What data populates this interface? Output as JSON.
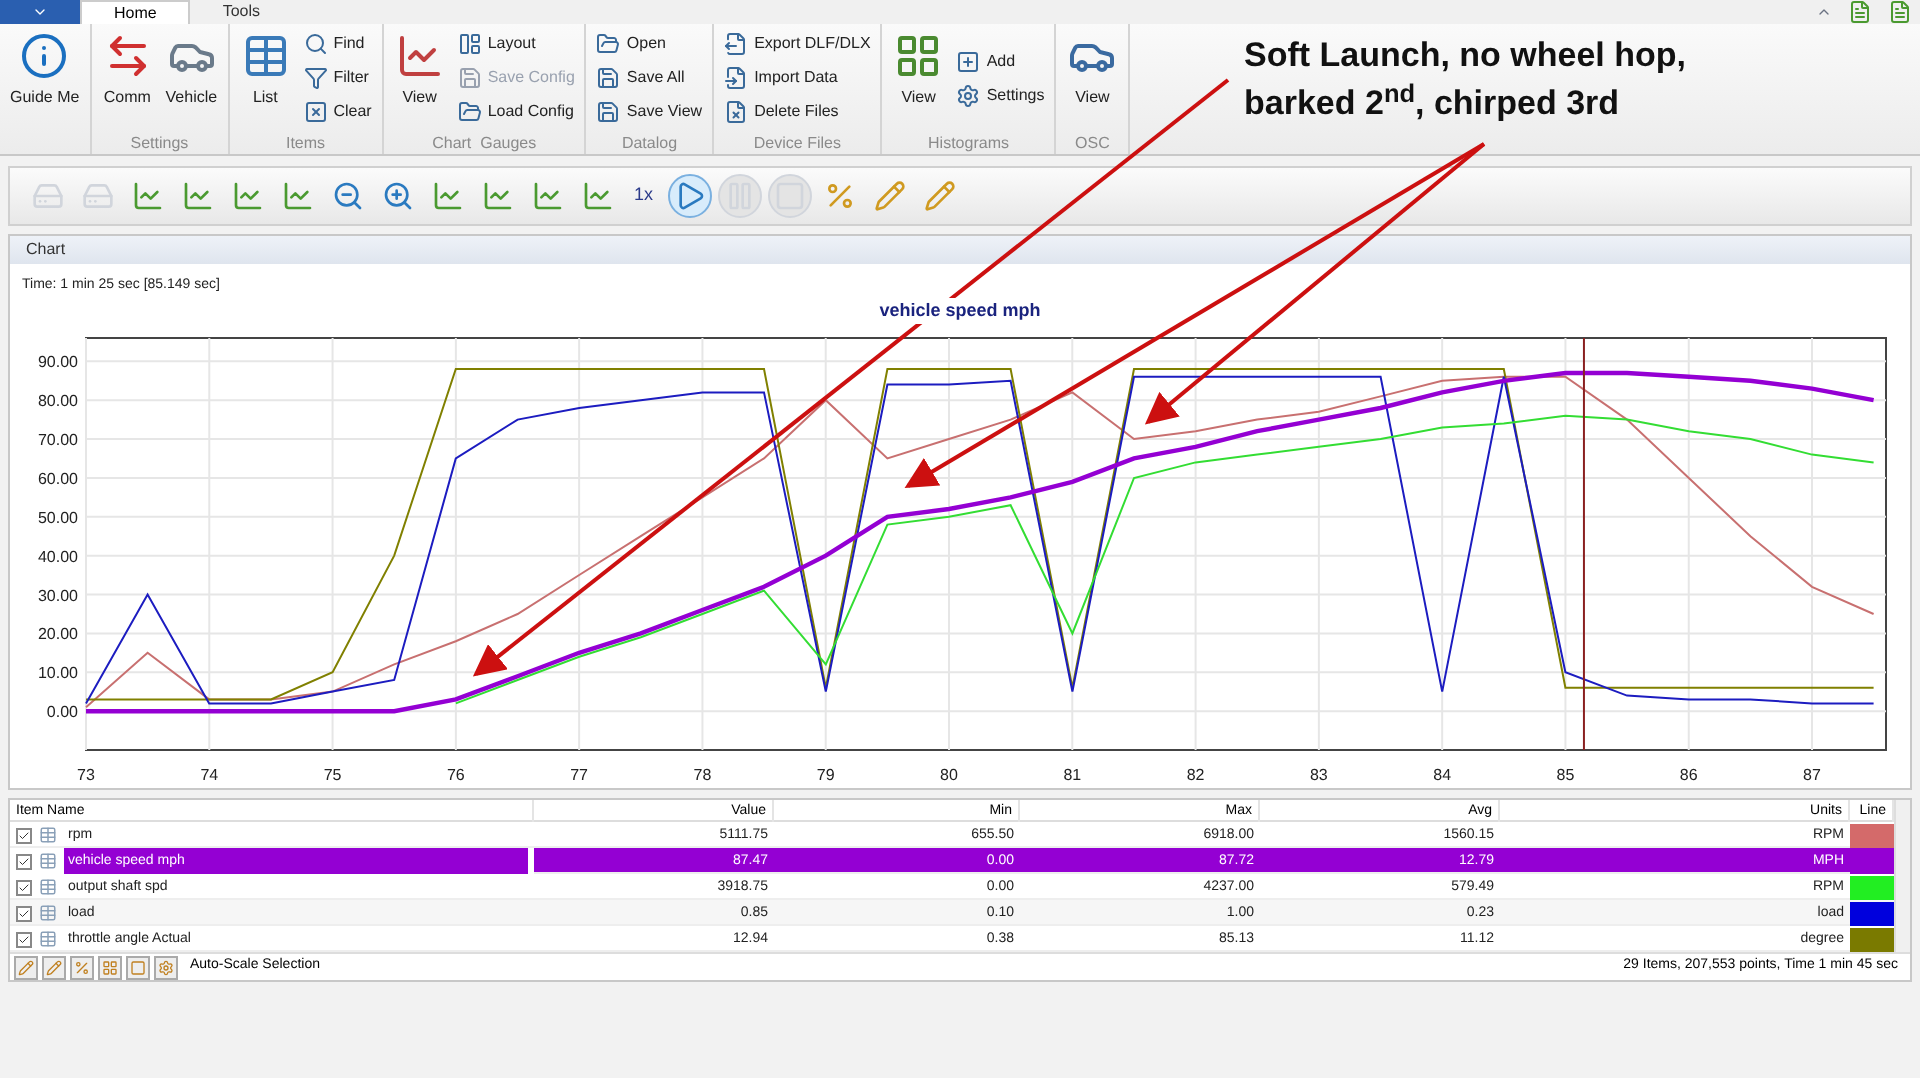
{
  "ribbon": {
    "tabs": [
      {
        "label": "Home",
        "selected": true
      },
      {
        "label": "Tools",
        "selected": false
      }
    ],
    "groups": [
      {
        "items": [
          {
            "label": "Guide Me",
            "kind": "large",
            "disabled": false
          }
        ]
      },
      {
        "label": "Settings",
        "items": [
          {
            "label": "Comm",
            "kind": "large",
            "disabled": false
          },
          {
            "label": "Vehicle",
            "kind": "large",
            "disabled": false
          }
        ]
      },
      {
        "label": "Items",
        "items": [
          {
            "label": "List",
            "kind": "large",
            "disabled": false
          },
          {
            "label": "Find",
            "kind": "small",
            "disabled": false
          },
          {
            "label": "Filter",
            "kind": "small",
            "disabled": false
          },
          {
            "label": "Clear",
            "kind": "small",
            "disabled": false
          }
        ]
      },
      {
        "label": "Chart  Gauges",
        "items": [
          {
            "label": "View",
            "kind": "large",
            "disabled": false
          },
          {
            "label": "Layout",
            "kind": "small",
            "disabled": false
          },
          {
            "label": "Save Config",
            "kind": "small",
            "disabled": true
          },
          {
            "label": "Load Config",
            "kind": "small",
            "disabled": false
          }
        ]
      },
      {
        "label": "Datalog",
        "items": [
          {
            "label": "Open",
            "kind": "small",
            "disabled": false
          },
          {
            "label": "Save All",
            "kind": "small",
            "disabled": false
          },
          {
            "label": "Save View",
            "kind": "small",
            "disabled": false
          }
        ]
      },
      {
        "label": "Device Files",
        "items": [
          {
            "label": "Export DLF/DLX",
            "kind": "small",
            "disabled": false
          },
          {
            "label": "Import Data",
            "kind": "small",
            "disabled": false
          },
          {
            "label": "Delete Files",
            "kind": "small",
            "disabled": false
          }
        ]
      },
      {
        "label": "Histograms",
        "items": [
          {
            "label": "View",
            "kind": "large",
            "disabled": false
          },
          {
            "label": "Add",
            "kind": "small",
            "disabled": false
          },
          {
            "label": "Settings",
            "kind": "small",
            "disabled": false
          }
        ]
      },
      {
        "label": "OSC",
        "items": [
          {
            "label": "View",
            "kind": "large",
            "disabled": false
          }
        ]
      }
    ]
  },
  "annotation": {
    "text": "Soft Launch, no wheel hop, barked 2$^{nd}$, chirped 3rd"
  },
  "toolbar": {
    "items": [
      {
        "disabled": true
      },
      {
        "disabled": true
      },
      {
        "disabled": false
      },
      {
        "disabled": false
      },
      {
        "disabled": false
      },
      {
        "disabled": false
      },
      {
        "disabled": false
      },
      {
        "disabled": false
      },
      {
        "disabled": false
      },
      {
        "disabled": false
      },
      {
        "disabled": false
      },
      {
        "disabled": false
      },
      {
        "label": "1x",
        "disabled": false
      },
      {
        "disabled": false
      },
      {
        "disabled": true
      },
      {
        "disabled": true
      },
      {
        "disabled": false
      },
      {
        "disabled": false
      },
      {
        "disabled": false
      }
    ]
  },
  "chart_panel": {
    "title": "Chart",
    "time": "Time: 1 min 25 sec [85.149 sec]",
    "chart_data": {
      "type": "line",
      "title": "vehicle speed mph",
      "grid": true,
      "x": [
        73,
        73.5,
        74,
        74.5,
        75,
        75.5,
        76,
        76.5,
        77,
        77.5,
        78,
        78.5,
        79,
        79.5,
        80,
        80.5,
        81,
        81.5,
        82,
        82.5,
        83,
        83.5,
        84,
        84.5,
        85,
        85.5,
        86,
        86.5,
        87,
        87.5
      ],
      "series": [
        {
          "color": "#c87070",
          "values": [
            1,
            15,
            3,
            3,
            5,
            12,
            18,
            25,
            35,
            45,
            55,
            65,
            80,
            65,
            70,
            75,
            82,
            70,
            72,
            75,
            77,
            81,
            85,
            86,
            86,
            75,
            60,
            45,
            32,
            25
          ]
        },
        {
          "color": "#808000",
          "values": [
            3,
            3,
            3,
            3,
            10,
            40,
            88,
            88,
            88,
            88,
            88,
            88,
            6,
            88,
            88,
            88,
            6,
            88,
            88,
            88,
            88,
            88,
            88,
            88,
            6,
            6,
            6,
            6,
            6,
            6
          ]
        },
        {
          "color": "#1c1cc0",
          "values": [
            2,
            30,
            2,
            2,
            5,
            8,
            65,
            75,
            78,
            80,
            82,
            82,
            5,
            84,
            84,
            85,
            5,
            86,
            86,
            86,
            86,
            86,
            5,
            86,
            10,
            4,
            3,
            3,
            2,
            2
          ]
        },
        {
          "color": "#33dd33",
          "values": [
            null,
            null,
            null,
            null,
            null,
            null,
            2,
            8,
            14,
            19,
            25,
            31,
            12,
            48,
            50,
            53,
            20,
            60,
            64,
            66,
            68,
            70,
            73,
            74,
            76,
            75,
            72,
            70,
            66,
            64
          ]
        },
        {
          "color": "#9400d3",
          "values": [
            0,
            0,
            0,
            0,
            0,
            0,
            3,
            9,
            15,
            20,
            26,
            32,
            40,
            50,
            52,
            55,
            59,
            65,
            68,
            72,
            75,
            78,
            82,
            85,
            87,
            87,
            86,
            85,
            83,
            80
          ]
        }
      ],
      "xlim": [
        73,
        87.6
      ],
      "ylim": [
        -10,
        96
      ],
      "xticks": [
        73,
        74,
        75,
        76,
        77,
        78,
        79,
        80,
        81,
        82,
        83,
        84,
        85,
        86,
        87
      ],
      "yticks": [
        {
          "value": 0,
          "label": "0.00"
        },
        {
          "value": 10,
          "label": "10.00"
        },
        {
          "value": 20,
          "label": "20.00"
        },
        {
          "value": 30,
          "label": "30.00"
        },
        {
          "value": 40,
          "label": "40.00"
        },
        {
          "value": 50,
          "label": "50.00"
        },
        {
          "value": 60,
          "label": "60.00"
        },
        {
          "value": 70,
          "label": "70.00"
        },
        {
          "value": 80,
          "label": "80.00"
        },
        {
          "value": 90,
          "label": "90.00"
        }
      ],
      "ref_lines": [
        {
          "axis": "x",
          "value": 85.15,
          "color": "#8a2020"
        }
      ]
    }
  },
  "table": {
    "columns": [
      "Item Name",
      "Value",
      "Min",
      "Max",
      "Avg",
      "Units",
      "Line"
    ],
    "rows": [
      {
        "checked": true,
        "selected": false,
        "name": "rpm",
        "value": "5111.75",
        "min": "655.50",
        "max": "6918.00",
        "avg": "1560.15",
        "units": "RPM",
        "color": "#d46a6a"
      },
      {
        "checked": true,
        "selected": true,
        "name": "vehicle speed mph",
        "value": "87.47",
        "min": "0.00",
        "max": "87.72",
        "avg": "12.79",
        "units": "MPH",
        "color": "#9400d3"
      },
      {
        "checked": true,
        "selected": false,
        "name": "output shaft spd",
        "value": "3918.75",
        "min": "0.00",
        "max": "4237.00",
        "avg": "579.49",
        "units": "RPM",
        "color": "#22ee22"
      },
      {
        "checked": true,
        "selected": false,
        "name": "load",
        "value": "0.85",
        "min": "0.10",
        "max": "1.00",
        "avg": "0.23",
        "units": "load",
        "color": "#0000dd"
      },
      {
        "checked": true,
        "selected": false,
        "name": "throttle angle Actual",
        "value": "12.94",
        "min": "0.38",
        "max": "85.13",
        "avg": "11.12",
        "units": "degree",
        "color": "#7a7a00"
      }
    ]
  },
  "footer": {
    "auto_scale": "Auto-Scale Selection",
    "status": "29 Items, 207,553 points, Time 1 min 45 sec"
  }
}
